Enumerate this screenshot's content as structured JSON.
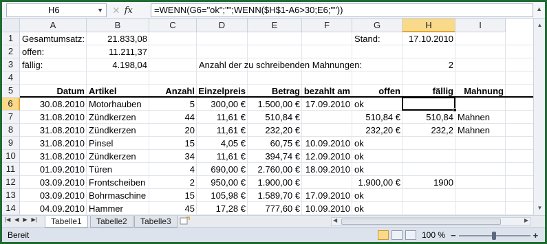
{
  "formula_bar": {
    "name_box": "H6",
    "fx_label": "fx",
    "cancel_glyph": "✕",
    "formula": "=WENN(G6=\"ok\";\"\";WENN($H$1-A6>30;E6;\"\"))"
  },
  "columns": [
    "A",
    "B",
    "C",
    "D",
    "E",
    "F",
    "G",
    "H",
    "I"
  ],
  "rows": [
    "1",
    "2",
    "3",
    "4",
    "5",
    "6",
    "7",
    "8",
    "9",
    "10",
    "11",
    "12",
    "13",
    "14"
  ],
  "summary": {
    "gesamt_label": "Gesamtumsatz:",
    "gesamt_value": "21.833,08",
    "offen_label": "offen:",
    "offen_value": "11.211,37",
    "faellig_label": "fällig:",
    "faellig_value": "4.198,04",
    "stand_label": "Stand:",
    "stand_value": "17.10.2010",
    "mahn_label": "Anzahl der zu schreibenden Mahnungen:",
    "mahn_value": "2"
  },
  "table": {
    "headers": [
      "Datum",
      "Artikel",
      "Anzahl",
      "Einzelpreis",
      "Betrag",
      "bezahlt am",
      "offen",
      "fällig",
      "Mahnung"
    ],
    "rows": [
      [
        "30.08.2010",
        "Motorhauben",
        "5",
        "300,00 €",
        "1.500,00 €",
        "17.09.2010",
        "ok",
        "",
        "",
        ""
      ],
      [
        "31.08.2010",
        "Zündkerzen",
        "44",
        "11,61 €",
        "510,84 €",
        "",
        "510,84 €",
        "510,84",
        "Mahnen"
      ],
      [
        "31.08.2010",
        "Zündkerzen",
        "20",
        "11,61 €",
        "232,20 €",
        "",
        "232,20 €",
        "232,2",
        "Mahnen"
      ],
      [
        "31.08.2010",
        "Pinsel",
        "15",
        "4,05 €",
        "60,75 €",
        "10.09.2010",
        "ok",
        "",
        ""
      ],
      [
        "31.08.2010",
        "Zündkerzen",
        "34",
        "11,61 €",
        "394,74 €",
        "12.09.2010",
        "ok",
        "",
        ""
      ],
      [
        "01.09.2010",
        "Türen",
        "4",
        "690,00 €",
        "2.760,00 €",
        "18.09.2010",
        "ok",
        "",
        ""
      ],
      [
        "03.09.2010",
        "Frontscheiben",
        "2",
        "950,00 €",
        "1.900,00 €",
        "",
        "1.900,00 €",
        "1900",
        ""
      ],
      [
        "03.09.2010",
        "Bohrmaschine",
        "15",
        "105,98 €",
        "1.589,70 €",
        "17.09.2010",
        "ok",
        "",
        ""
      ],
      [
        "04.09.2010",
        "Hammer",
        "45",
        "17,28 €",
        "777,60 €",
        "10.09.2010",
        "ok",
        "",
        ""
      ]
    ]
  },
  "sheet_tabs": [
    "Tabelle1",
    "Tabelle2",
    "Tabelle3"
  ],
  "status": {
    "ready": "Bereit",
    "zoom": "100 %",
    "minus": "−",
    "plus": "+"
  },
  "colors": {
    "frame": "#1f6b33",
    "selection": "#f9d98a"
  }
}
